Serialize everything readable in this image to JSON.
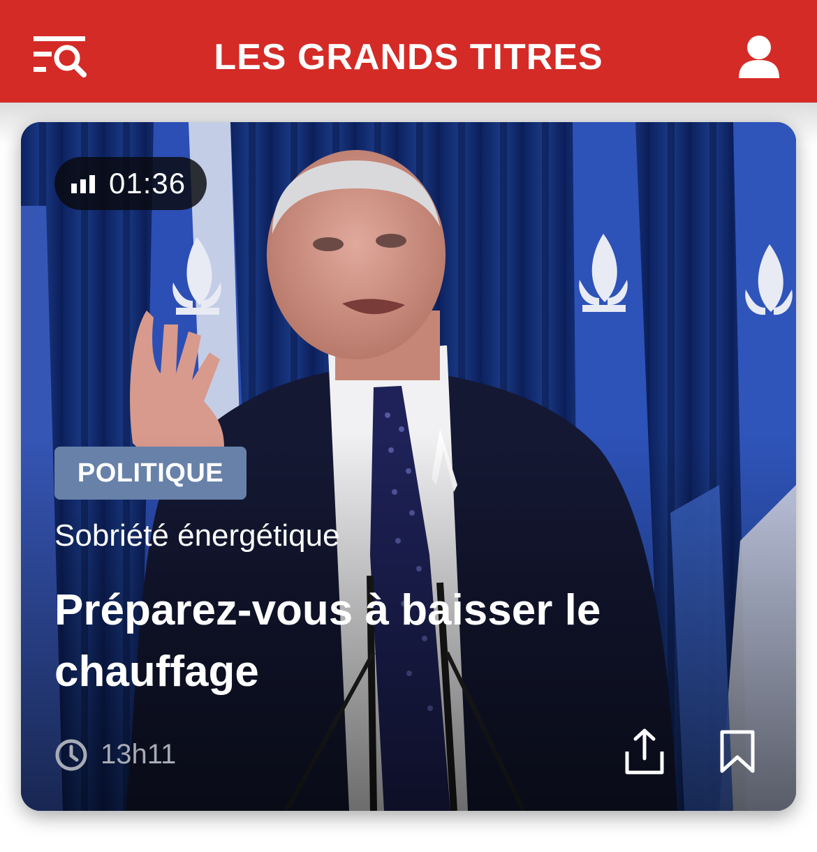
{
  "header": {
    "title": "LES GRANDS TITRES",
    "background_color": "#d42b27",
    "menu_icon": "menu-search-icon",
    "profile_icon": "user-icon"
  },
  "article": {
    "duration": "01:36",
    "category": "POLITIQUE",
    "category_color": "#6781a9",
    "kicker": "Sobriété énergétique",
    "headline": "Préparez-vous à baisser le chauffage",
    "time": "13h11",
    "icons": {
      "duration": "audio-bars-icon",
      "time": "clock-icon",
      "share": "share-icon",
      "bookmark": "bookmark-icon"
    }
  }
}
